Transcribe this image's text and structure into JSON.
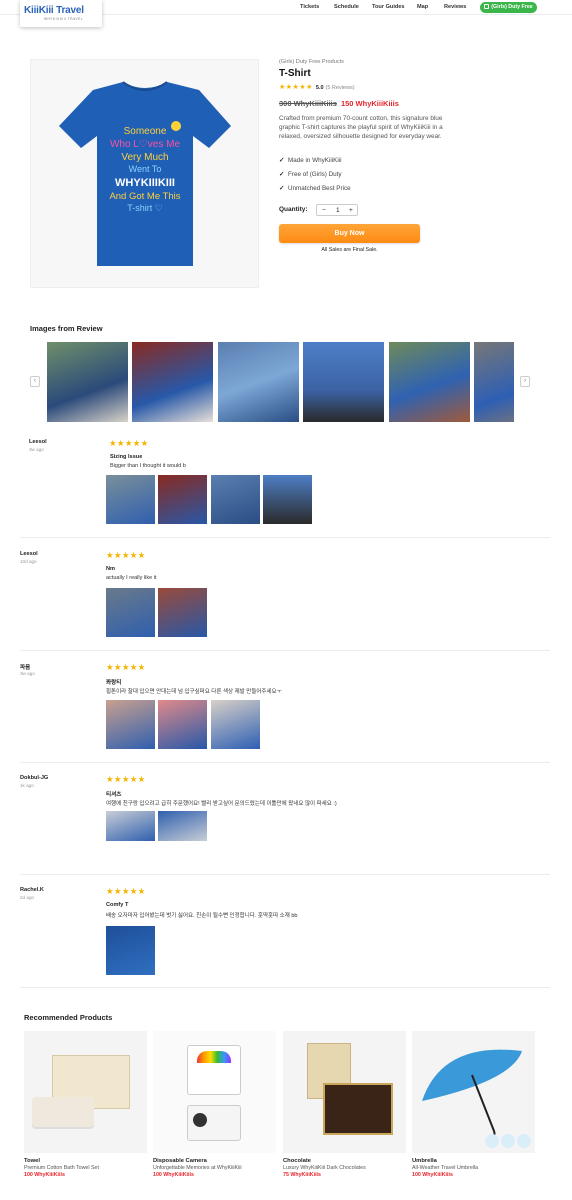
{
  "header": {
    "logo_text": "KiiiKiii Travel",
    "logo_sub": "WHYKIIIKIII TRAVEL",
    "nav": [
      "Tickets",
      "Schedule",
      "Tour Guides",
      "Map",
      "Reviews"
    ],
    "duty_button": "(Girls) Duty Free"
  },
  "product": {
    "category": "(Girls) Duty Free Products",
    "title": "T-Shirt",
    "stars": "★★★★★",
    "score": "5.0",
    "reviews": "(5 Reviews)",
    "old_price": "300 WhyKiiiKiiis",
    "new_price": "150 WhyKiiiKiiis",
    "description": "Crafted from premium 70-count cotton, this signature blue graphic T-shirt captures the playful spirit of WhyKiiiKiii in a relaxed, oversized silhouette designed for everyday wear.",
    "features": [
      "Made in WhyKiiiKiii",
      "Free of (Girls) Duty",
      "Unmatched Best Price"
    ],
    "quantity_label": "Quantity:",
    "quantity": "1",
    "buy_label": "Buy Now",
    "final_note": "All Sales are Final Sale.",
    "shirt_text": [
      "Someone",
      "Who L♡ves Me",
      "Very Much",
      "Went To",
      "WHYKIIIKIII",
      "And Got Me This",
      "T-shirt ♡"
    ]
  },
  "review_images_title": "Images from Review",
  "reviews": [
    {
      "name": "Leesol",
      "date": "3w ago",
      "stars": "★★★★★",
      "title": "Sizing Issue",
      "body": "Bigger than I thought it would b"
    },
    {
      "name": "Leesol",
      "date": "10d ago",
      "stars": "★★★★★",
      "title": "Nm",
      "body": "actually I really like it"
    },
    {
      "name": "파음",
      "date": "3w ago",
      "stars": "★★★★★",
      "title": "퐈랑티",
      "body": "횡톤이라 찰대 입으면 안대는데 넘 입구싶퍼요 다른 색상 제발 만들어주세요ㅜ"
    },
    {
      "name": "Dokbul-JG",
      "date": "1k ago",
      "stars": "★★★★★",
      "title": "티셔츠",
      "body": "여행에 친구랑 입으려고 급히 주문했어요! 빨리 받고싶어 문의드렸는데 이틀만에 왔네요 많이 파세요 :)"
    },
    {
      "name": "Rachel.K",
      "date": "2d ago",
      "stars": "★★★★★",
      "title": "Comfy T",
      "body": "배송 오자마자 입어봤는데 벗기 싫어요. 친손이 될수뻔 인정합니다. 훗딱훗따 소재 bb"
    }
  ],
  "recommended_title": "Recommended Products",
  "recommended": [
    {
      "name": "Towel",
      "desc": "Premium Cotton Bath Towel Set",
      "price": "100 WhyKiiiKiiis"
    },
    {
      "name": "Disposable Camera",
      "desc": "Unforgettable Memories at WhyKiiiKiii",
      "price": "100 WhyKiiiKiiis"
    },
    {
      "name": "Chocolate",
      "desc": "Luxury WhyKiiiKiii Dark Chocolates",
      "price": "75 WhyKiiiKiiis"
    },
    {
      "name": "Umbrella",
      "desc": "All-Weather Travel Umbrella",
      "price": "100 WhyKiiiKiiis"
    }
  ],
  "colors": {
    "accent": "#ff8b12",
    "price": "#e5242c",
    "duty": "#3cb54a",
    "shirt": "#1f5fb5"
  }
}
